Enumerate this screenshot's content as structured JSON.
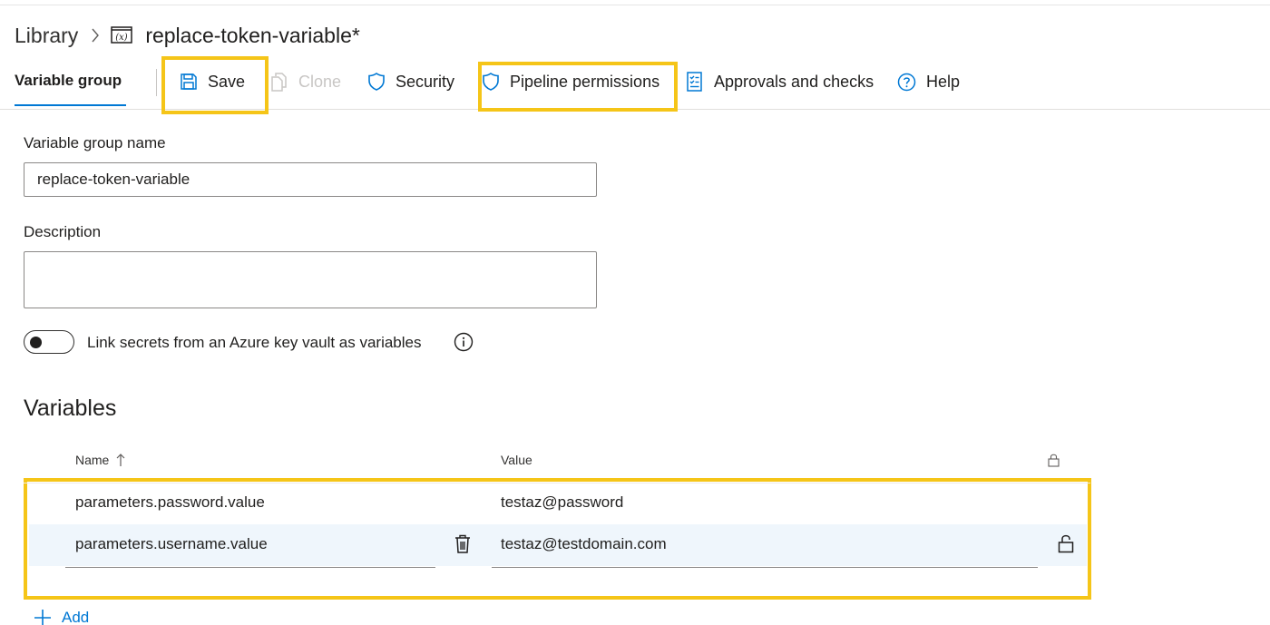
{
  "breadcrumb": {
    "root": "Library",
    "title": "replace-token-variable*"
  },
  "toolbar": {
    "tab_label": "Variable group",
    "save_label": "Save",
    "clone_label": "Clone",
    "security_label": "Security",
    "pipeline_permissions_label": "Pipeline permissions",
    "approvals_label": "Approvals and checks",
    "help_label": "Help"
  },
  "form": {
    "name_label": "Variable group name",
    "name_value": "replace-token-variable",
    "description_label": "Description",
    "description_value": "",
    "keyvault_toggle_label": "Link secrets from an Azure key vault as variables",
    "keyvault_toggle_on": false
  },
  "variables": {
    "heading": "Variables",
    "columns": {
      "name": "Name",
      "value": "Value"
    },
    "rows": [
      {
        "name": "parameters.password.value",
        "value": "testaz@password"
      },
      {
        "name": "parameters.username.value",
        "value": "testaz@testdomain.com"
      }
    ],
    "add_label": "Add"
  },
  "colors": {
    "accent": "#0078d4",
    "highlight": "#f5c518",
    "selected_row": "#eff6fc"
  },
  "icons": [
    "chevron-right-icon",
    "variable-icon",
    "save-icon",
    "clone-icon",
    "shield-icon",
    "checklist-icon",
    "help-icon",
    "info-icon",
    "sort-up-icon",
    "lock-icon",
    "trash-icon",
    "plus-icon"
  ]
}
